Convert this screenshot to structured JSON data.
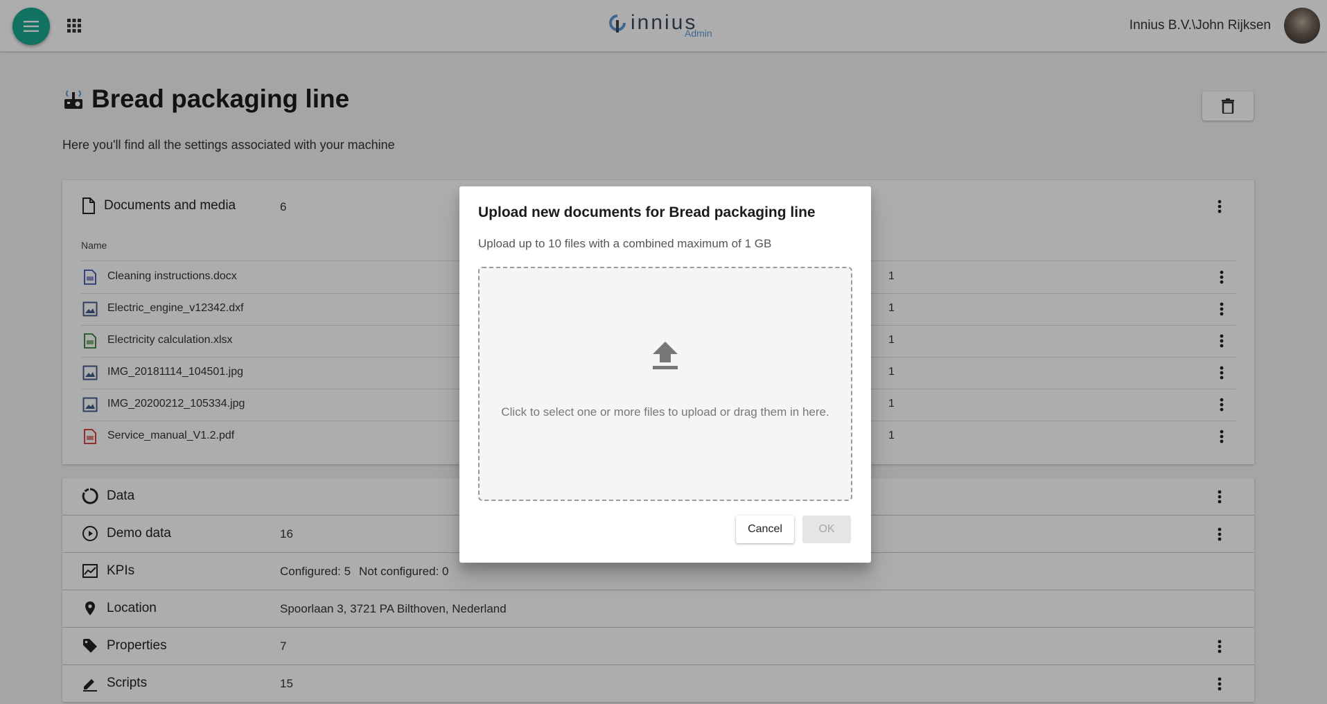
{
  "header": {
    "logo_text": "innius",
    "logo_sub": "Admin",
    "user": "Innius B.V.\\John Rijksen"
  },
  "page": {
    "title": "Bread packaging line",
    "subtitle": "Here you'll find all the settings associated with your machine"
  },
  "documents": {
    "title": "Documents and media",
    "count": "6",
    "column_name": "Name",
    "rows": [
      {
        "name": "Cleaning instructions.docx",
        "type": "docx",
        "extra": "1"
      },
      {
        "name": "Electric_engine_v12342.dxf",
        "type": "image",
        "extra": "1"
      },
      {
        "name": "Electricity calculation.xlsx",
        "type": "xlsx",
        "extra": "1"
      },
      {
        "name": "IMG_20181114_104501.jpg",
        "type": "image",
        "extra": "1"
      },
      {
        "name": "IMG_20200212_105334.jpg",
        "type": "image",
        "extra": "1"
      },
      {
        "name": "Service_manual_V1.2.pdf",
        "type": "pdf",
        "extra": "1"
      }
    ]
  },
  "sections": {
    "data": {
      "title": "Data"
    },
    "demo": {
      "title": "Demo data",
      "value": "16"
    },
    "kpis": {
      "title": "KPIs",
      "configured": "Configured: 5",
      "not_configured": "Not configured: 0"
    },
    "location": {
      "title": "Location",
      "value": "Spoorlaan 3, 3721 PA Bilthoven, Nederland"
    },
    "properties": {
      "title": "Properties",
      "value": "7"
    },
    "scripts": {
      "title": "Scripts",
      "value": "15"
    }
  },
  "dialog": {
    "title": "Upload new documents for Bread packaging line",
    "subtitle": "Upload up to 10 files with a combined maximum of 1 GB",
    "drop_text": "Click to select one or more files to upload or drag them in here.",
    "cancel": "Cancel",
    "ok": "OK"
  },
  "colors": {
    "accent": "#1aa890",
    "logo_sub": "#5a9bd6",
    "docx": "#3f51b5",
    "xlsx": "#2e7d32",
    "pdf": "#d32f2f",
    "image": "#455a8a"
  }
}
